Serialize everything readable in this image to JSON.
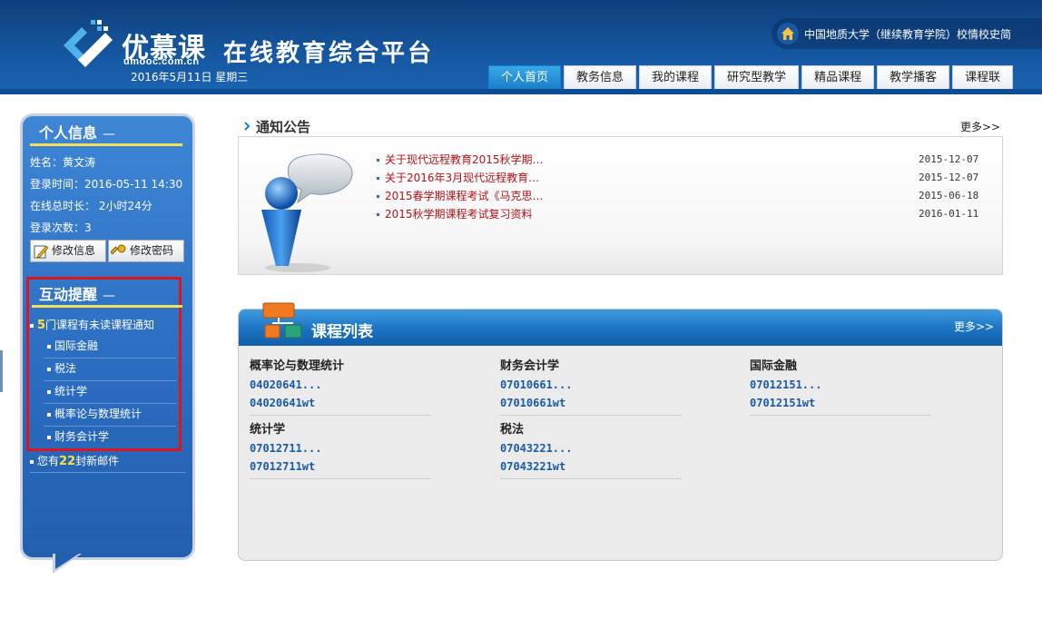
{
  "header": {
    "logo_text": "优慕课",
    "logo_domain": "umooc.com.cn",
    "platform_title": "在线教育综合平台",
    "date": "2016年5月11日 星期三",
    "school_info": "中国地质大学（继续教育学院）校情校史简",
    "nav": [
      {
        "label": "个人首页",
        "active": true
      },
      {
        "label": "教务信息"
      },
      {
        "label": "我的课程"
      },
      {
        "label": "研究型教学"
      },
      {
        "label": "精品课程"
      },
      {
        "label": "教学播客"
      },
      {
        "label": "课程联"
      }
    ]
  },
  "sidebar": {
    "personal": {
      "title": "个人信息",
      "dash": "—",
      "name": "姓名：黄文涛",
      "login_time": "登录时间：2016-05-11 14:30",
      "online_total": "在线总时长：  2小时24分",
      "login_count": "登录次数：3",
      "edit_info": "修改信息",
      "edit_password": "修改密码"
    },
    "remind": {
      "title": "互动提醒",
      "dash": "—",
      "unread_count": "5",
      "unread_text": "门课程有未读课程通知",
      "courses": [
        "国际金融",
        "税法",
        "统计学",
        "概率论与数理统计",
        "财务会计学"
      ],
      "mail_prefix": "您有",
      "mail_count": "22",
      "mail_suffix": "封新邮件"
    }
  },
  "notice": {
    "title": "通知公告",
    "more": "更多>>",
    "items": [
      {
        "title": "关于现代远程教育2015秋学期…",
        "date": "2015-12-07"
      },
      {
        "title": "关于2016年3月现代远程教育…",
        "date": "2015-12-07"
      },
      {
        "title": "2015春学期课程考试《马克思…",
        "date": "2015-06-18"
      },
      {
        "title": "2015秋学期课程考试复习资料",
        "date": "2016-01-11"
      }
    ]
  },
  "courses": {
    "title": "课程列表",
    "more": "更多>>",
    "items": [
      {
        "name": "概率论与数理统计",
        "code1": "04020641...",
        "code2": "04020641wt"
      },
      {
        "name": "财务会计学",
        "code1": "07010661...",
        "code2": "07010661wt"
      },
      {
        "name": "国际金融",
        "code1": "07012151...",
        "code2": "07012151wt"
      },
      {
        "name": "统计学",
        "code1": "07012711...",
        "code2": "07012711wt"
      },
      {
        "name": "税法",
        "code1": "07043221...",
        "code2": "07043221wt"
      }
    ]
  },
  "colors": {
    "header_blue": "#15569f",
    "active_tab": "#1b7fcc",
    "notice_red": "#b31217",
    "highlight_yellow": "#ffe33a",
    "reminder_border": "#e0141a"
  }
}
